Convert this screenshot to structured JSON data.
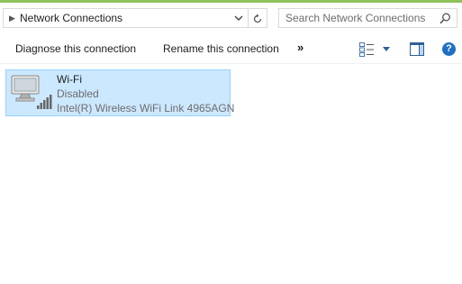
{
  "address_bar": {
    "path": "Network Connections",
    "breadcrumb_icon": "chevron-right-icon",
    "dropdown_icon": "chevron-down-icon",
    "refresh_icon": "refresh-icon"
  },
  "search": {
    "placeholder": "Search Network Connections",
    "icon": "search-icon"
  },
  "toolbar": {
    "diagnose_label": "Diagnose this connection",
    "rename_label": "Rename this connection",
    "more_label": "»",
    "view_icon": "change-view-icon",
    "preview_pane_icon": "preview-pane-icon",
    "help_label": "?"
  },
  "connections": [
    {
      "name": "Wi-Fi",
      "status": "Disabled",
      "device": "Intel(R) Wireless WiFi Link 4965AGN",
      "icon": "wifi-adapter-icon",
      "selected": true
    }
  ],
  "colors": {
    "accent_line": "#8fc25a",
    "selection_bg": "#cce8ff",
    "selection_border": "#99d1ff",
    "help_blue": "#1f6fc4"
  }
}
